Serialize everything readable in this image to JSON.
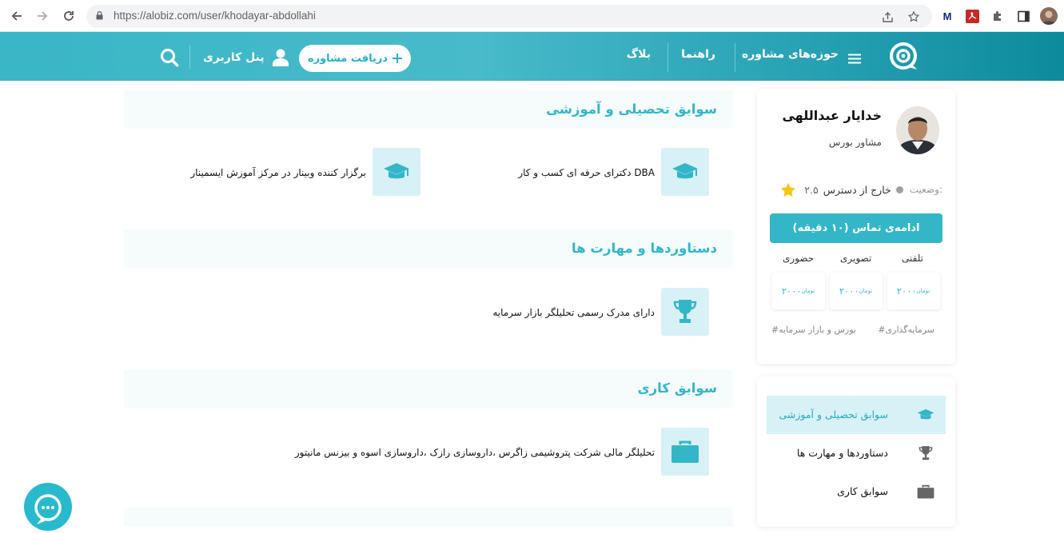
{
  "browser": {
    "url": "https://alobiz.com/user/khodayar-abdollahi"
  },
  "header": {
    "nav": [
      "حوزه‌های مشاوره",
      "راهنما",
      "بلاگ"
    ],
    "consult_button": "دریافت مشاوره",
    "user_panel": "پنل کاربری",
    "colors": {
      "accent": "#33b6c8",
      "header_from": "#3ab6c6",
      "header_to": "#0d8a9c"
    }
  },
  "sections": [
    {
      "title": "سوابق تحصیلی و آموزشی",
      "icon": "graduation-cap-icon",
      "items": [
        "DBA دکترای حرفه ای کسب و کار",
        "برگزار کننده وبینار در مرکز آموزش ایسمینار"
      ]
    },
    {
      "title": "دستاوردها و مهارت ها",
      "icon": "trophy-icon",
      "items": [
        "دارای مدرک رسمی تحلیلگر بازار سرمایه"
      ]
    },
    {
      "title": "سوابق کاری",
      "icon": "briefcase-icon",
      "items": [
        "تحلیلگر مالی شرکت پتروشیمی زاگرس ،داروسازی رازک ،داروسازی اسوه و بیزنس مانیتور"
      ]
    }
  ],
  "profile": {
    "name": "خدایار عبداللهی",
    "title": "مشاور بورس",
    "status_label": "وضعیت:",
    "status_value": "خارج از دسترس",
    "rating": "۲.۵",
    "call_button": "ادامه‌ی تماس (۱۰ دقیقه)",
    "call_types": [
      {
        "label": "تلفنی",
        "price": "۲۰۰۰"
      },
      {
        "label": "تصویری",
        "price": "۲۰۰۰"
      },
      {
        "label": "حضوری",
        "price": "۲۰۰۰"
      }
    ],
    "price_unit": "تومان",
    "tags": [
      "#سرمایه‌گذاری",
      "#بورس و بازار سرمایه"
    ]
  },
  "side_menu": [
    {
      "label": "سوابق تحصیلی و آموزشی",
      "icon": "graduation-cap-icon",
      "active": true
    },
    {
      "label": "دستاوردها و مهارت ها",
      "icon": "trophy-icon",
      "active": false
    },
    {
      "label": "سوابق کاری",
      "icon": "briefcase-icon",
      "active": false
    }
  ]
}
